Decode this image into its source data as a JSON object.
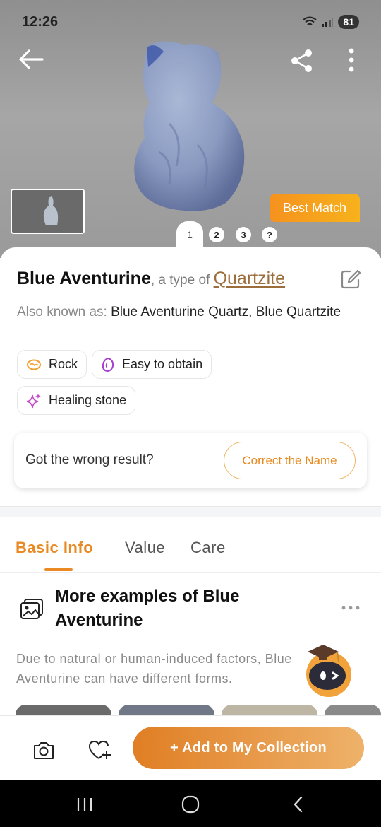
{
  "status_bar": {
    "time": "12:26",
    "signal": "LTE",
    "battery": "81"
  },
  "hero": {
    "best_match_label": "Best Match",
    "pager": [
      "1",
      "2",
      "3",
      "?"
    ]
  },
  "stone": {
    "name": "Blue Aventurine",
    "type_prefix": ", a type of ",
    "type_link": "Quartzite",
    "aka_label": "Also known as: ",
    "aka_value": "Blue Aventurine Quartz, Blue Quartzite",
    "tags": [
      {
        "label": "Rock",
        "icon": "rock-icon"
      },
      {
        "label": "Easy to obtain",
        "icon": "obtain-icon"
      },
      {
        "label": "Healing stone",
        "icon": "sparkle-icon"
      }
    ]
  },
  "wrong_result": {
    "question": "Got the wrong result?",
    "button": "Correct the Name"
  },
  "tabs": [
    {
      "label": "Basic Info",
      "active": true
    },
    {
      "label": "Value"
    },
    {
      "label": "Care"
    }
  ],
  "examples": {
    "title": "More examples of Blue Aventurine",
    "description": "Due to natural or human-induced factors, Blue Aventurine can have different forms."
  },
  "bottom_bar": {
    "add_label": "+ Add to My Collection"
  },
  "colors": {
    "accent": "#e98a25",
    "link": "#9c6e3c",
    "best_match": "#f5921e"
  }
}
